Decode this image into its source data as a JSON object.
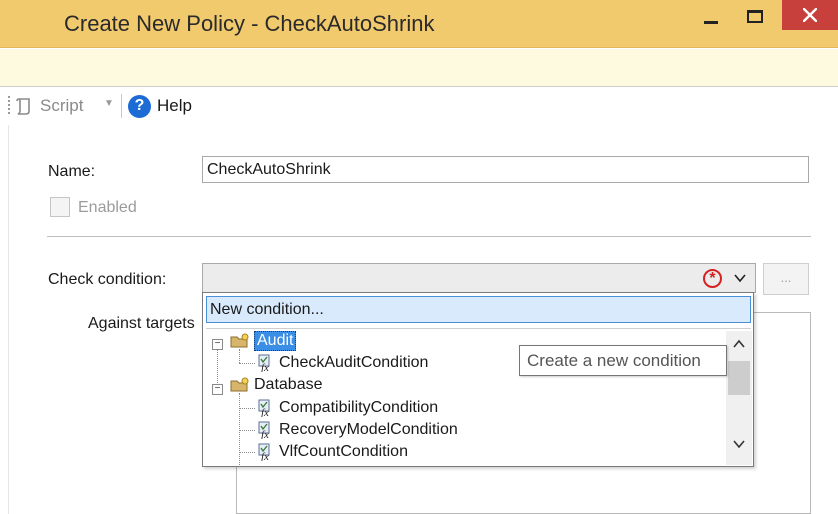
{
  "window": {
    "title": "Create New Policy - CheckAutoShrink"
  },
  "toolbar": {
    "script_label": "Script",
    "help_label": "Help"
  },
  "form": {
    "name_label": "Name:",
    "name_value": "CheckAutoShrink",
    "enabled_label": "Enabled",
    "enabled_checked": false,
    "check_condition_label": "Check condition:",
    "against_targets_label": "Against targets",
    "browse_label": "..."
  },
  "dropdown": {
    "new_condition_label": "New condition...",
    "tree": [
      {
        "label": "Audit",
        "type": "folder",
        "selected": true,
        "children": [
          {
            "label": "CheckAuditCondition"
          }
        ]
      },
      {
        "label": "Database",
        "type": "folder",
        "selected": false,
        "children": [
          {
            "label": "CompatibilityCondition"
          },
          {
            "label": "RecoveryModelCondition"
          },
          {
            "label": "VlfCountCondition"
          }
        ]
      }
    ]
  },
  "tooltip": {
    "text": "Create a new condition"
  },
  "colors": {
    "title_bar": "#f2ca6e",
    "info_bar": "#fefadf",
    "close_button": "#c7403b",
    "selection": "#3a8ee6",
    "error": "#d42222"
  }
}
